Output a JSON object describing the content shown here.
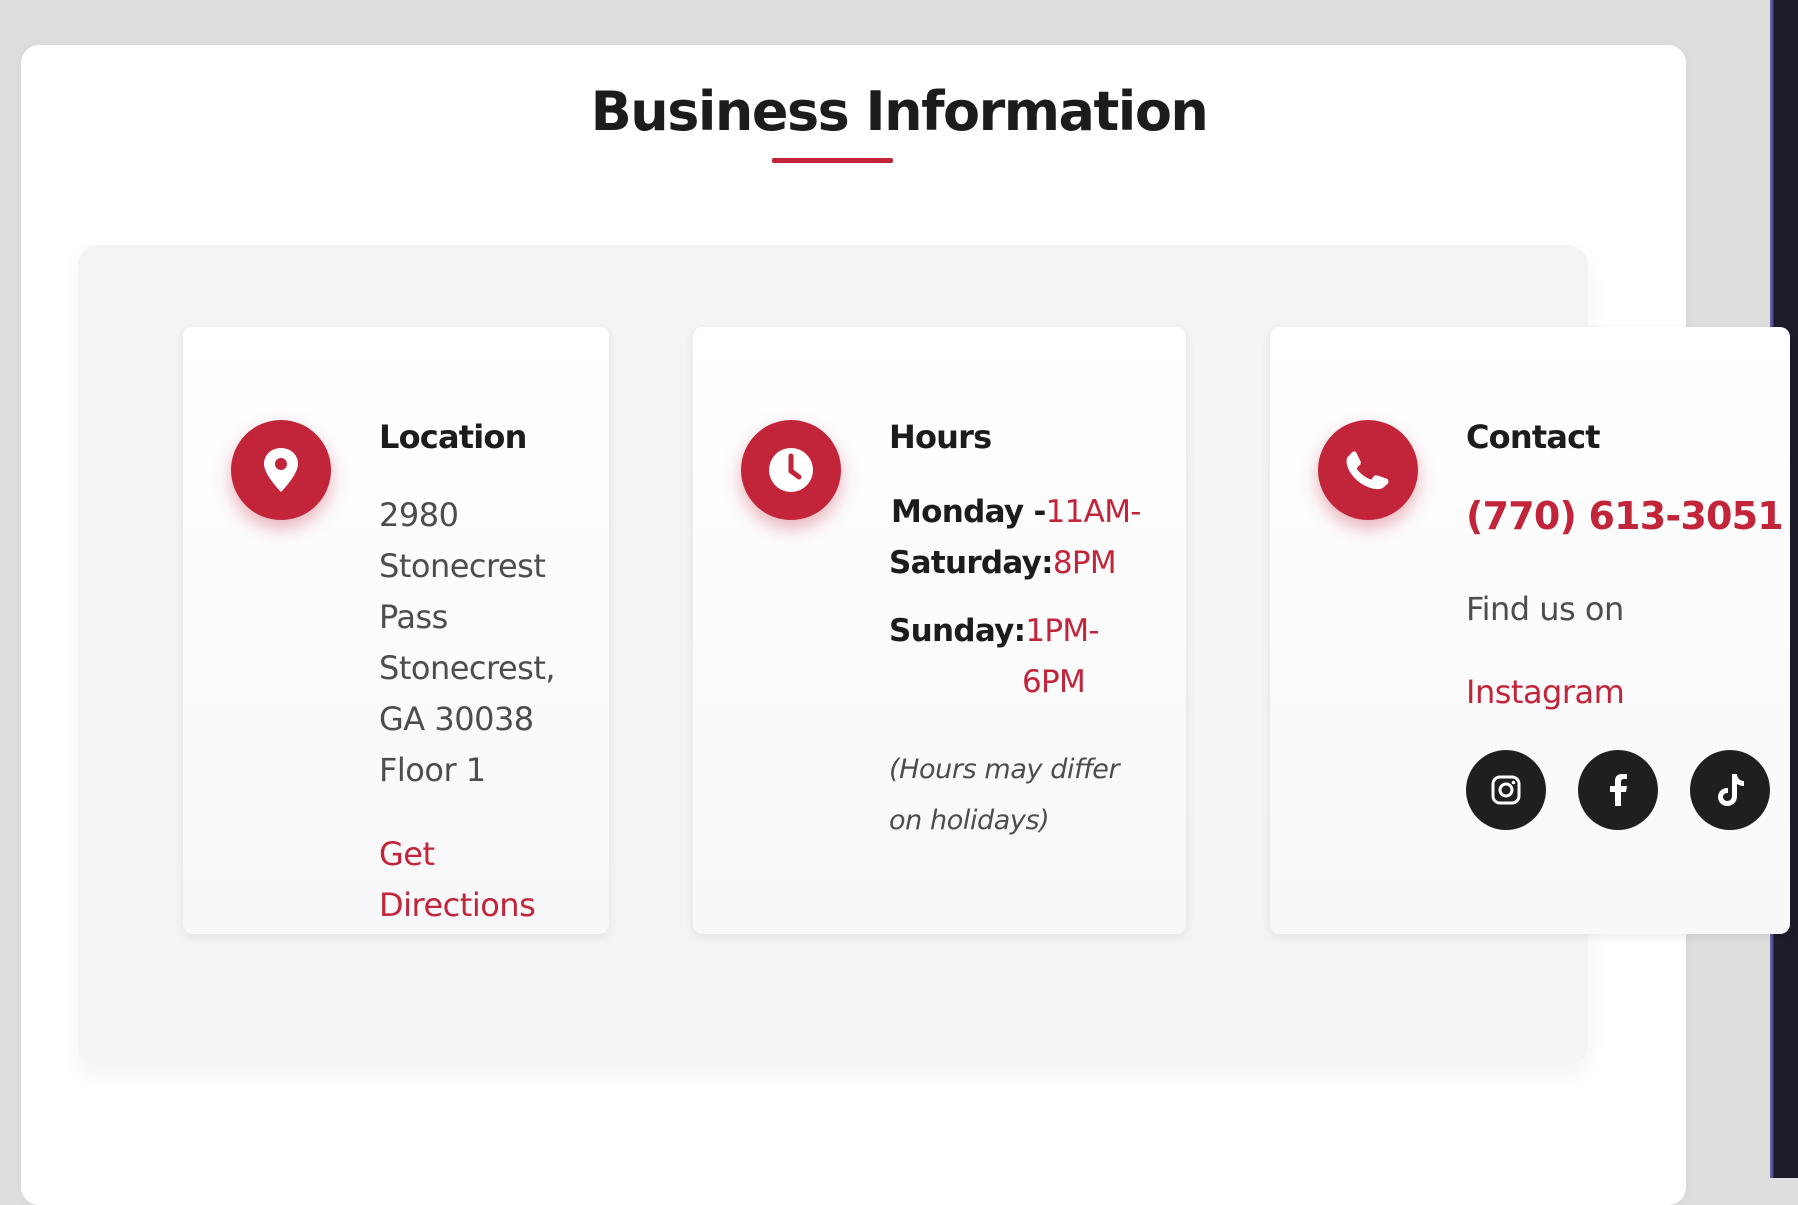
{
  "section": {
    "title": "Business Information"
  },
  "location": {
    "heading": "Location",
    "address_lines": [
      "2980",
      "Stonecrest",
      "Pass",
      "Stonecrest,",
      "GA 30038",
      "Floor 1"
    ],
    "directions_line1": "Get",
    "directions_line2": "Directions",
    "icon": "map-pin-icon"
  },
  "hours": {
    "heading": "Hours",
    "weekday_label_1": "Monday -",
    "weekday_label_2": "Saturday:",
    "weekday_time_1": "11AM-",
    "weekday_time_2": "8PM",
    "sunday_label": "Sunday:",
    "sunday_time_1": "1PM-",
    "sunday_time_2": "6PM",
    "note_line1": "(Hours may differ",
    "note_line2": "on holidays)",
    "icon": "clock-icon"
  },
  "contact": {
    "heading": "Contact",
    "phone": "(770) 613-3051",
    "find_us": "Find us on",
    "instagram_link": "Instagram",
    "icon": "phone-icon",
    "socials": [
      "instagram-icon",
      "facebook-icon",
      "tiktok-icon"
    ]
  },
  "colors": {
    "accent": "#c2243a",
    "heading": "#1c1c1c",
    "body": "#4d4d4d",
    "social_bg": "#1f1f1f"
  }
}
